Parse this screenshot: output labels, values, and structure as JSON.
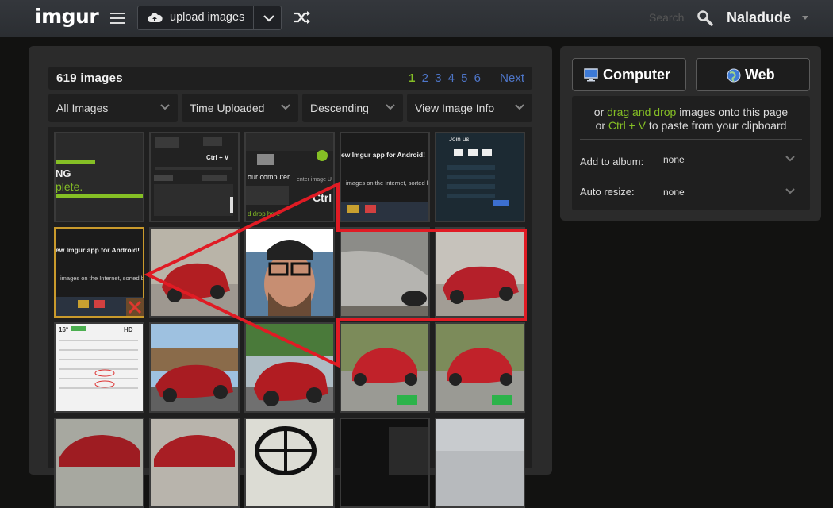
{
  "header": {
    "logo": "imgur",
    "upload_label": "upload images",
    "search_placeholder": "Search",
    "username": "Naladude"
  },
  "gallery": {
    "count_label": "619 images",
    "pages": [
      "1",
      "2",
      "3",
      "4",
      "5",
      "6"
    ],
    "current_page": "1",
    "next_label": "Next",
    "filters": [
      {
        "label": "All Images"
      },
      {
        "label": "Time Uploaded"
      },
      {
        "label": "Descending"
      },
      {
        "label": "View Image Info"
      }
    ]
  },
  "screenshot_text": {
    "t1_a": "NG",
    "t1_b": "plete.",
    "t2_a": "Ctrl + V",
    "t3_a": "our computer",
    "t3_b": "d drop here",
    "t3_c": "Ctrl",
    "t3_d": "enter image U",
    "t4_a": "ew Imgur app for Android!",
    "t4_b": "images on the Internet, sorted by",
    "t5_a": "Join us.",
    "t6_a": "ew Imgur app for Android!",
    "t6_b": "images on the Internet, sorted by",
    "t11_a": "16°",
    "t11_b": "HD"
  },
  "sidebar": {
    "computer_label": "Computer",
    "web_label": "Web",
    "drop_line1_prefix": "or ",
    "drop_line1_link": "drag and drop",
    "drop_line1_suffix": " images onto this page",
    "drop_line2_prefix": "or ",
    "drop_line2_link": "Ctrl + V",
    "drop_line2_suffix": " to paste from your clipboard",
    "album_label": "Add to album:",
    "album_value": "none",
    "resize_label": "Auto resize:",
    "resize_value": "none"
  },
  "colors": {
    "accent_green": "#85bf25",
    "link_blue": "#4e76c9",
    "selected_border": "#c99a2c",
    "annotation_red": "#e01b24"
  }
}
